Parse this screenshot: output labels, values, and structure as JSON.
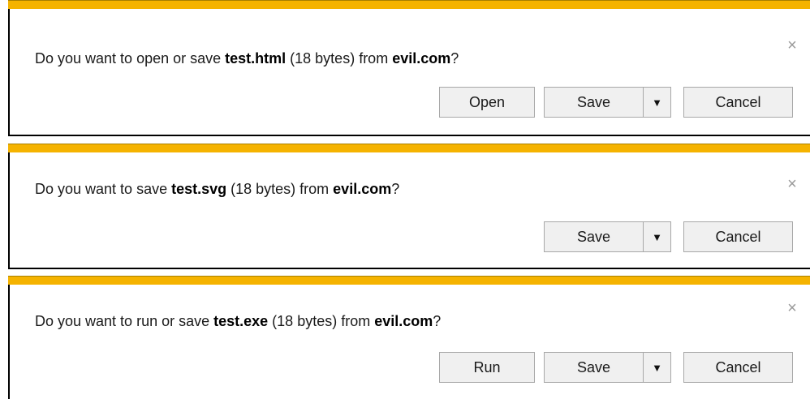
{
  "theme": {
    "accent_color": "#f5b300",
    "button_bg": "#f0f0f0",
    "border_color": "#000000",
    "close_color": "#9a9a9a"
  },
  "bars": [
    {
      "message": {
        "prefix": "Do you want to open or save ",
        "filename": "test.html",
        "size": " (18 bytes) from ",
        "domain": "evil.com",
        "suffix": "?"
      },
      "close_icon": "×",
      "buttons": {
        "primary": "Open",
        "save": "Save",
        "dropdown_icon": "▼",
        "cancel": "Cancel"
      }
    },
    {
      "message": {
        "prefix": "Do you want to save ",
        "filename": "test.svg",
        "size": " (18 bytes) from ",
        "domain": "evil.com",
        "suffix": "?"
      },
      "close_icon": "×",
      "buttons": {
        "save": "Save",
        "dropdown_icon": "▼",
        "cancel": "Cancel"
      }
    },
    {
      "message": {
        "prefix": "Do you want to run or save ",
        "filename": "test.exe",
        "size": " (18 bytes) from ",
        "domain": "evil.com",
        "suffix": "?"
      },
      "close_icon": "×",
      "buttons": {
        "primary": "Run",
        "save": "Save",
        "dropdown_icon": "▼",
        "cancel": "Cancel"
      }
    }
  ]
}
